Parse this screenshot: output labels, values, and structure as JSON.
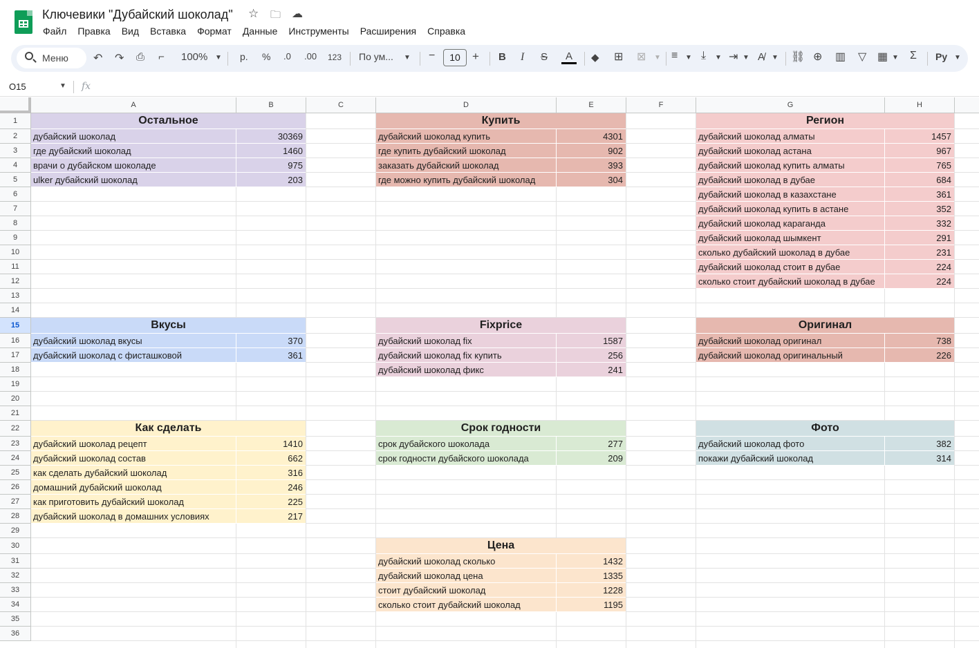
{
  "window": {
    "title": "Ключевики \"Дубайский шоколад\"",
    "title_icons": [
      "star-icon",
      "move-to-folder-icon",
      "cloud-saved-icon"
    ]
  },
  "menu": [
    "Файл",
    "Правка",
    "Вид",
    "Вставка",
    "Формат",
    "Данные",
    "Инструменты",
    "Расширения",
    "Справка"
  ],
  "toolbar": {
    "search_placeholder": "Меню",
    "zoom": "100%",
    "currency": "р.",
    "percent": "%",
    "decrease_decimal": ".0",
    "increase_decimal": ".00",
    "number_format": "123",
    "font_name": "По ум...",
    "font_size": "10",
    "input_tools": "Pу",
    "icons": [
      "undo-icon",
      "redo-icon",
      "print-icon",
      "paint-format-icon",
      "bold-icon",
      "italic-icon",
      "strikethrough-icon",
      "text-color-icon",
      "fill-color-icon",
      "borders-icon",
      "merge-cells-icon",
      "align-icon",
      "vertical-align-icon",
      "text-wrap-icon",
      "text-rotation-icon",
      "link-icon",
      "comment-icon",
      "chart-icon",
      "filter-icon",
      "table-view-icon",
      "functions-icon"
    ]
  },
  "formula_bar": {
    "cell_ref": "O15",
    "fx_label": "fx",
    "content": ""
  },
  "sheet": {
    "selected_row": "15",
    "columns": [
      "A",
      "B",
      "C",
      "D",
      "E",
      "F",
      "G",
      "H"
    ],
    "rows": [
      "1",
      "2",
      "3",
      "4",
      "5",
      "6",
      "7",
      "8",
      "9",
      "10",
      "11",
      "12",
      "13",
      "14",
      "15",
      "16",
      "17",
      "18",
      "19",
      "20",
      "21",
      "22",
      "23",
      "24",
      "25",
      "26",
      "27",
      "28",
      "29",
      "30",
      "31",
      "32",
      "33",
      "34",
      "35",
      "36"
    ],
    "blocks": [
      {
        "title": "Остальное",
        "color": "#d9d2e9",
        "rows": [
          [
            "дубайский шоколад",
            "30369"
          ],
          [
            "где дубайский шоколад",
            "1460"
          ],
          [
            "врачи о дубайском шоколаде",
            "975"
          ],
          [
            "ulker дубайский шоколад",
            "203"
          ]
        ]
      },
      {
        "title": "Купить",
        "color": "#e6b8af",
        "rows": [
          [
            "дубайский шоколад купить",
            "4301"
          ],
          [
            "где купить дубайский шоколад",
            "902"
          ],
          [
            "заказать дубайский шоколад",
            "393"
          ],
          [
            "где можно купить дубайский шоколад",
            "304"
          ]
        ]
      },
      {
        "title": "Регион",
        "color": "#f4cccc",
        "rows": [
          [
            "дубайский шоколад алматы",
            "1457"
          ],
          [
            "дубайский шоколад астана",
            "967"
          ],
          [
            "дубайский шоколад купить алматы",
            "765"
          ],
          [
            "дубайский шоколад в дубае",
            "684"
          ],
          [
            "дубайский шоколад в казахстане",
            "361"
          ],
          [
            "дубайский шоколад купить в астане",
            "352"
          ],
          [
            "дубайский шоколад караганда",
            "332"
          ],
          [
            "дубайский шоколад шымкент",
            "291"
          ],
          [
            "сколько дубайский шоколад в дубае",
            "231"
          ],
          [
            "дубайский шоколад стоит в дубае",
            "224"
          ],
          [
            "сколько стоит дубайский шоколад в дубае",
            "224"
          ]
        ]
      },
      {
        "title": "Вкусы",
        "color": "#c9daf8",
        "rows": [
          [
            "дубайский шоколад вкусы",
            "370"
          ],
          [
            "дубайский шоколад с фисташковой",
            "361"
          ]
        ]
      },
      {
        "title": "Fixprice",
        "color": "#ead1dc",
        "rows": [
          [
            "дубайский шоколад fix",
            "1587"
          ],
          [
            "дубайский шоколад fix купить",
            "256"
          ],
          [
            "дубайский шоколад фикс",
            "241"
          ]
        ]
      },
      {
        "title": "Оригинал",
        "color": "#e6b8af",
        "rows": [
          [
            "дубайский шоколад оригинал",
            "738"
          ],
          [
            "дубайский шоколад оригинальный",
            "226"
          ]
        ]
      },
      {
        "title": "Как сделать",
        "color": "#fff2cc",
        "rows": [
          [
            "дубайский шоколад рецепт",
            "1410"
          ],
          [
            "дубайский шоколад состав",
            "662"
          ],
          [
            "как сделать дубайский шоколад",
            "316"
          ],
          [
            "домашний дубайский шоколад",
            "246"
          ],
          [
            "как приготовить дубайский шоколад",
            "225"
          ],
          [
            "дубайский шоколад в домашних условиях",
            "217"
          ]
        ]
      },
      {
        "title": "Срок годности",
        "color": "#d9ead3",
        "rows": [
          [
            "срок дубайского шоколада",
            "277"
          ],
          [
            "срок годности дубайского шоколада",
            "209"
          ]
        ]
      },
      {
        "title": "Фото",
        "color": "#d0e0e3",
        "rows": [
          [
            "дубайский шоколад фото",
            "382"
          ],
          [
            "покажи дубайский шоколад",
            "314"
          ]
        ]
      },
      {
        "title": "Цена",
        "color": "#fce5cd",
        "rows": [
          [
            "дубайский шоколад сколько",
            "1432"
          ],
          [
            "дубайский шоколад цена",
            "1335"
          ],
          [
            "стоит дубайский шоколад",
            "1228"
          ],
          [
            "сколько стоит дубайский шоколад",
            "1195"
          ]
        ]
      }
    ]
  }
}
